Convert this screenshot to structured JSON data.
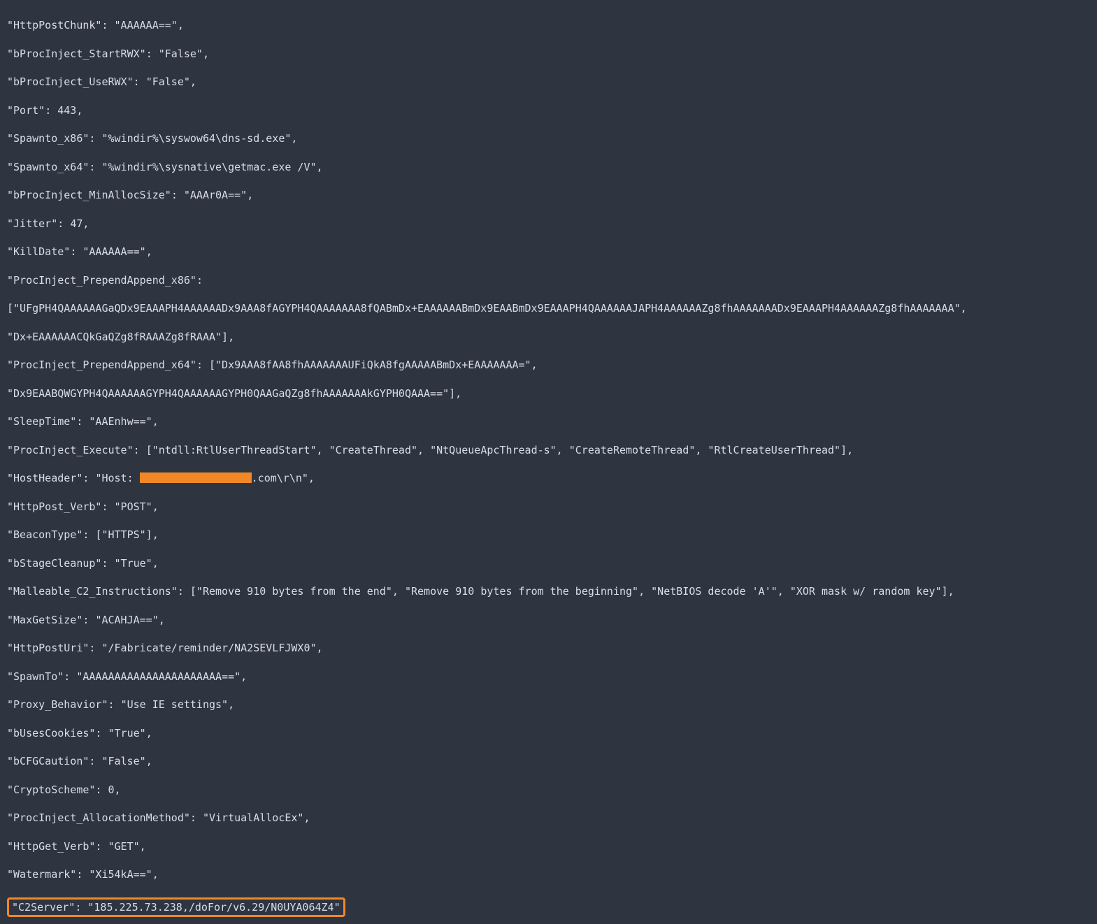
{
  "lines": {
    "l1_key": "\"HttpPostChunk\"",
    "l1_val": "\"AAAAAA==\"",
    "l2_key": "\"bProcInject_StartRWX\"",
    "l2_val": "\"False\"",
    "l3_key": "\"bProcInject_UseRWX\"",
    "l3_val": "\"False\"",
    "l4_key": "\"Port\"",
    "l4_val": "443",
    "l5_key": "\"Spawnto_x86\"",
    "l5_val": "\"%windir%\\syswow64\\dns-sd.exe\"",
    "l6_key": "\"Spawnto_x64\"",
    "l6_val": "\"%windir%\\sysnative\\getmac.exe /V\"",
    "l7_key": "\"bProcInject_MinAllocSize\"",
    "l7_val": "\"AAAr0A==\"",
    "l8_key": "\"Jitter\"",
    "l8_val": "47",
    "l9_key": "\"KillDate\"",
    "l9_val": "\"AAAAAA==\"",
    "l10_key": "\"ProcInject_PrependAppend_x86\"",
    "l10b": "[\"UFgPH4QAAAAAAGaQDx9EAAAPH4AAAAAADx9AAA8fAGYPH4QAAAAAAA8fQABmDx+EAAAAAABmDx9EAABmDx9EAAAPH4QAAAAAAJAPH4AAAAAAZg8fhAAAAAAADx9EAAAPH4AAAAAAZg8fhAAAAAAA\",",
    "l10c": "\"Dx+EAAAAAACQkGaQZg8fRAAAZg8fRAAA\"],",
    "l11_key": "\"ProcInject_PrependAppend_x64\"",
    "l11_val": "[\"Dx9AAA8fAA8fhAAAAAAAUFiQkA8fgAAAAABmDx+EAAAAAAA=\",",
    "l11c": "\"Dx9EAABQWGYPH4QAAAAAAGYPH4QAAAAAAGYPH0QAAGaQZg8fhAAAAAAAkGYPH0QAAA==\"],",
    "l12_key": "\"SleepTime\"",
    "l12_val": "\"AAEnhw==\"",
    "l13_key": "\"ProcInject_Execute\"",
    "l13_val": "[\"ntdll:RtlUserThreadStart\", \"CreateThread\", \"NtQueueApcThread-s\", \"CreateRemoteThread\", \"RtlCreateUserThread\"],",
    "l14_key": "\"HostHeader\"",
    "l14_pre": "\"Host: ",
    "l14_post": ".com\\r\\n\",",
    "l15_key": "\"HttpPost_Verb\"",
    "l15_val": "\"POST\"",
    "l16_key": "\"BeaconType\"",
    "l16_val": "[\"HTTPS\"],",
    "l17_key": "\"bStageCleanup\"",
    "l17_val": "\"True\"",
    "l18_key": "\"Malleable_C2_Instructions\"",
    "l18_val": "[\"Remove 910 bytes from the end\", \"Remove 910 bytes from the beginning\", \"NetBIOS decode 'A'\", \"XOR mask w/ random key\"],",
    "l19_key": "\"MaxGetSize\"",
    "l19_val": "\"ACAHJA==\"",
    "l20_key": "\"HttpPostUri\"",
    "l20_val": "\"/Fabricate/reminder/NA2SEVLFJWX0\"",
    "l21_key": "\"SpawnTo\"",
    "l21_val": "\"AAAAAAAAAAAAAAAAAAAAAA==\"",
    "l22_key": "\"Proxy_Behavior\"",
    "l22_val": "\"Use IE settings\"",
    "l23_key": "\"bUsesCookies\"",
    "l23_val": "\"True\"",
    "l24_key": "\"bCFGCaution\"",
    "l24_val": "\"False\"",
    "l25_key": "\"CryptoScheme\"",
    "l25_val": "0",
    "l26_key": "\"ProcInject_AllocationMethod\"",
    "l26_val": "\"VirtualAllocEx\"",
    "l27_key": "\"HttpGet_Verb\"",
    "l27_val": "\"GET\"",
    "l28_key": "\"Watermark\"",
    "l28_val": "\"Xi54kA==\"",
    "l29_key": "\"C2Server\"",
    "l29_val": "\"185.225.73.238,/doFor/v6.29/N0UYA064Z4\""
  }
}
